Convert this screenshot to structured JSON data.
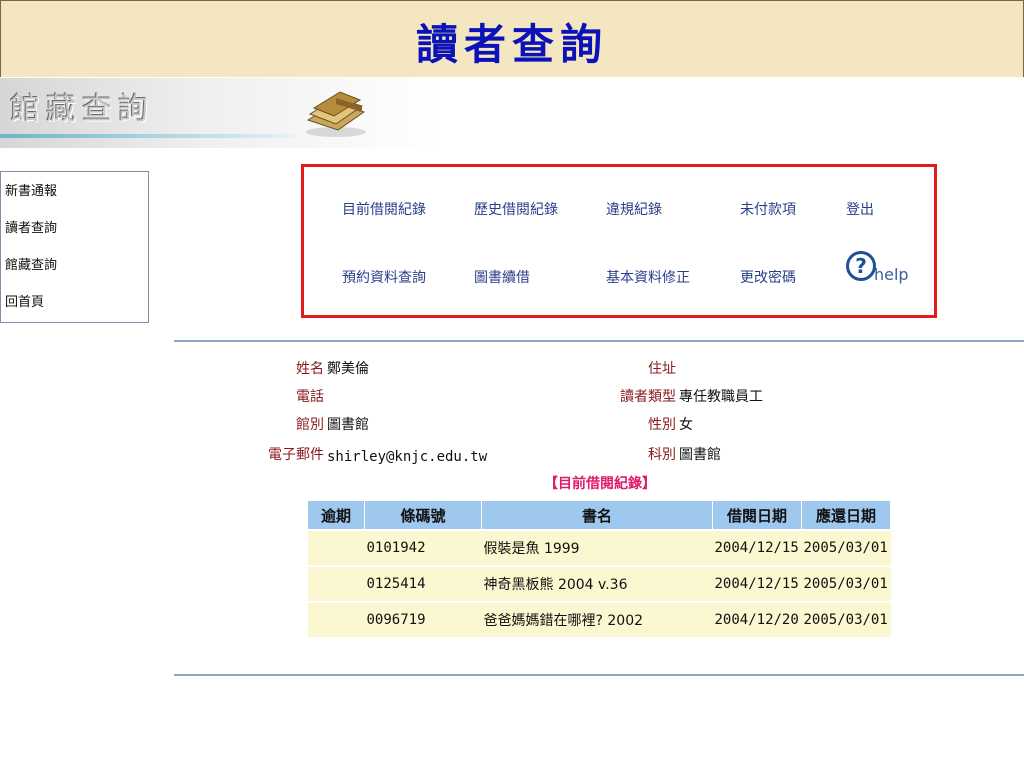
{
  "header": {
    "title": "讀者查詢"
  },
  "banner": {
    "logo_text": "館藏查詢",
    "books_icon": "books-icon"
  },
  "sidebar": {
    "items": [
      {
        "label": "新書通報"
      },
      {
        "label": "讀者查詢"
      },
      {
        "label": "館藏查詢"
      },
      {
        "label": "回首頁"
      }
    ]
  },
  "menu": {
    "row1": [
      "目前借閱紀錄",
      "歷史借閱紀錄",
      "違規紀錄",
      "未付款項",
      "登出"
    ],
    "row2": [
      "預約資料查詢",
      "圖書續借",
      "基本資料修正",
      "更改密碼"
    ],
    "help": {
      "icon": "question-circle-icon",
      "label": "help"
    }
  },
  "patron": {
    "labels": {
      "name": "姓名",
      "phone": "電話",
      "branch": "館別",
      "email": "電子郵件",
      "address": "住址",
      "reader_type": "讀者類型",
      "gender": "性別",
      "dept": "科別"
    },
    "values": {
      "name": "鄭美倫",
      "phone": "",
      "branch": "圖書館",
      "email": "shirley@knjc.edu.tw",
      "address": "",
      "reader_type": "專任教職員工",
      "gender": "女",
      "dept": "圖書館"
    }
  },
  "loans": {
    "section_title": "【目前借閱紀錄】",
    "columns": [
      "逾期",
      "條碼號",
      "書名",
      "借閱日期",
      "應還日期"
    ],
    "rows": [
      {
        "overdue": "",
        "barcode": "0101942",
        "title": "假裝是魚 1999",
        "borrowed": "2004/12/15",
        "due": "2005/03/01"
      },
      {
        "overdue": "",
        "barcode": "0125414",
        "title": "神奇黑板熊 2004 v.36",
        "borrowed": "2004/12/15",
        "due": "2005/03/01"
      },
      {
        "overdue": "",
        "barcode": "0096719",
        "title": "爸爸媽媽錯在哪裡? 2002",
        "borrowed": "2004/12/20",
        "due": "2005/03/01"
      }
    ]
  },
  "colors": {
    "title_text": "#0a12b8",
    "title_bg": "#f3e6c0",
    "menu_border": "#e11a1a",
    "link": "#2a3f8a",
    "label": "#8b1a1a",
    "table_header": "#9fc8ef",
    "table_row": "#fbf7d0",
    "section_title": "#e11a6a"
  }
}
